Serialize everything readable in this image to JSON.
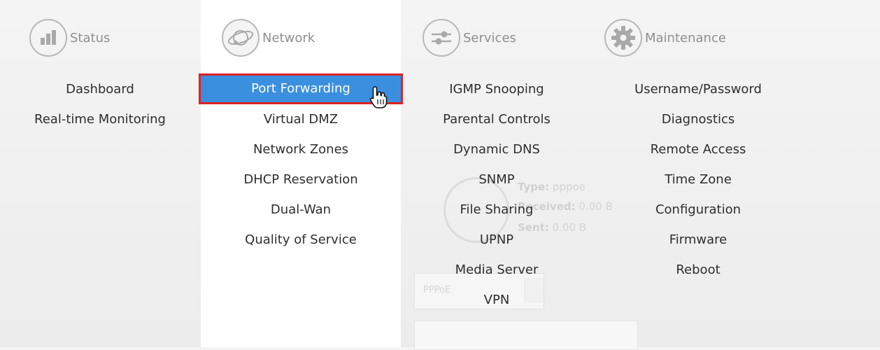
{
  "columns": [
    {
      "id": "status",
      "label": "Status",
      "icon": "bar-chart-icon",
      "items": [
        "Dashboard",
        "Real-time Monitoring"
      ]
    },
    {
      "id": "network",
      "label": "Network",
      "icon": "globe-orbit-icon",
      "items": [
        "Port Forwarding",
        "Virtual DMZ",
        "Network Zones",
        "DHCP Reservation",
        "Dual-Wan",
        "Quality of Service"
      ],
      "active_item": "Port Forwarding"
    },
    {
      "id": "services",
      "label": "Services",
      "icon": "sliders-icon",
      "items": [
        "IGMP Snooping",
        "Parental Controls",
        "Dynamic DNS",
        "SNMP",
        "File Sharing",
        "UPNP",
        "Media Server",
        "VPN"
      ]
    },
    {
      "id": "maintenance",
      "label": "Maintenance",
      "icon": "gear-icon",
      "items": [
        "Username/Password",
        "Diagnostics",
        "Remote Access",
        "Time Zone",
        "Configuration",
        "Firmware",
        "Reboot"
      ]
    }
  ],
  "background": {
    "type_label": "Type:",
    "type_value": "pppoe",
    "received_label": "Received:",
    "received_value": "0.00 B",
    "sent_label": "Sent:",
    "sent_value": "0.00 B",
    "connection_select": "PPPoE"
  },
  "colors": {
    "active_bg": "#3b8fdf",
    "highlight_border": "#e02222"
  }
}
